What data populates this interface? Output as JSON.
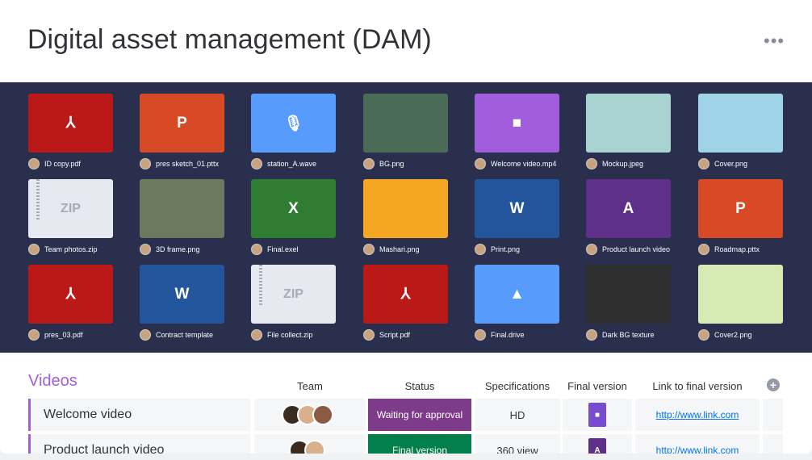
{
  "header": {
    "title": "Digital asset management (DAM)",
    "menu": "•••"
  },
  "assets": [
    {
      "name": "ID copy.pdf",
      "kind": "pdf",
      "color": "#bb1818",
      "glyph": "⅄"
    },
    {
      "name": "pres sketch_01.pttx",
      "kind": "ppt",
      "color": "#d84a26",
      "glyph": "P"
    },
    {
      "name": "station_A.wave",
      "kind": "audio",
      "color": "#579bfc",
      "glyph": "🎙"
    },
    {
      "name": "BG.png",
      "kind": "image",
      "color": "#4a6b55",
      "glyph": ""
    },
    {
      "name": "Welcome video.mp4",
      "kind": "video",
      "color": "#a25ddc",
      "glyph": "■"
    },
    {
      "name": "Mockup.jpeg",
      "kind": "image",
      "color": "#a9d3d0",
      "glyph": ""
    },
    {
      "name": "Cover.png",
      "kind": "image",
      "color": "#9fd4e8",
      "glyph": ""
    },
    {
      "name": "Team photos.zip",
      "kind": "zip",
      "color": "#e6e9ef",
      "glyph": "ZIP"
    },
    {
      "name": "3D frame.png",
      "kind": "image",
      "color": "#6b7a5e",
      "glyph": ""
    },
    {
      "name": "Final.exel",
      "kind": "excel",
      "color": "#2e7d32",
      "glyph": "X"
    },
    {
      "name": "Mashari.png",
      "kind": "image",
      "color": "#f5a623",
      "glyph": ""
    },
    {
      "name": "Print.png",
      "kind": "word",
      "color": "#23559d",
      "glyph": "W"
    },
    {
      "name": "Product launch video",
      "kind": "aftereffects",
      "color": "#5f3089",
      "glyph": "A"
    },
    {
      "name": "Roadmap.pttx",
      "kind": "ppt",
      "color": "#d84a26",
      "glyph": "P"
    },
    {
      "name": "pres_03.pdf",
      "kind": "pdf",
      "color": "#bb1818",
      "glyph": "⅄"
    },
    {
      "name": "Contract template",
      "kind": "word",
      "color": "#23559d",
      "glyph": "W"
    },
    {
      "name": "File collect.zip",
      "kind": "zip",
      "color": "#e6e9ef",
      "glyph": "ZIP"
    },
    {
      "name": "Script.pdf",
      "kind": "pdf",
      "color": "#bb1818",
      "glyph": "⅄"
    },
    {
      "name": "Final.drive",
      "kind": "drive",
      "color": "#579bfc",
      "glyph": "▲"
    },
    {
      "name": "Dark BG texture",
      "kind": "image",
      "color": "#2f2f2f",
      "glyph": ""
    },
    {
      "name": "Cover2.png",
      "kind": "image",
      "color": "#d6ebb4",
      "glyph": ""
    }
  ],
  "board": {
    "group": "Videos",
    "columns": [
      "Team",
      "Status",
      "Specifications",
      "Final version",
      "Link to final version"
    ],
    "rows": [
      {
        "name": "Welcome video",
        "team_count": 3,
        "status": "Waiting for approval",
        "status_color": "#7e3b8a",
        "spec": "HD",
        "file_color": "#784bd1",
        "file_glyph": "■",
        "link": "http://www.link.com"
      },
      {
        "name": "Product launch video",
        "team_count": 2,
        "status": "Final version",
        "status_color": "#037f4c",
        "spec": "360 view",
        "file_color": "#5f3089",
        "file_glyph": "A",
        "link": "http://www.link.com"
      }
    ]
  }
}
